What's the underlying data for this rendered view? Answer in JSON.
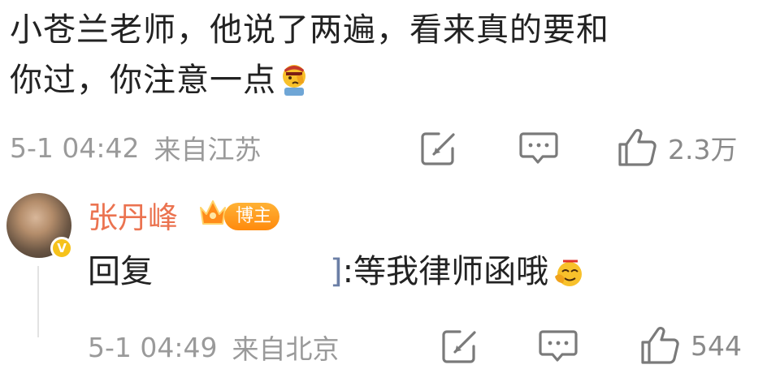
{
  "comment": {
    "line1": "小苍兰老师，他说了两遍，看来真的要和",
    "line2": "你过，你注意一点",
    "emoji": "facepalm-emoji",
    "time": "5-1 04:42",
    "location": "来自江苏",
    "like_count": "2.3万"
  },
  "reply": {
    "username": "张丹峰",
    "badge": "博主",
    "verified_mark": "V",
    "prefix": "回复",
    "partial_char": "]",
    "content": ":等我律师函哦",
    "emoji": "666-emoji",
    "time": "5-1 04:49",
    "location": "来自北京",
    "like_count": "544"
  },
  "colors": {
    "username": "#eb7350",
    "meta": "#9a9a9a",
    "icon": "#7a7a7a",
    "badge": "#ff9a1f",
    "verified": "#f6c21b"
  },
  "icons": {
    "repost": "repost-icon",
    "comment": "comment-icon",
    "like": "like-icon"
  }
}
